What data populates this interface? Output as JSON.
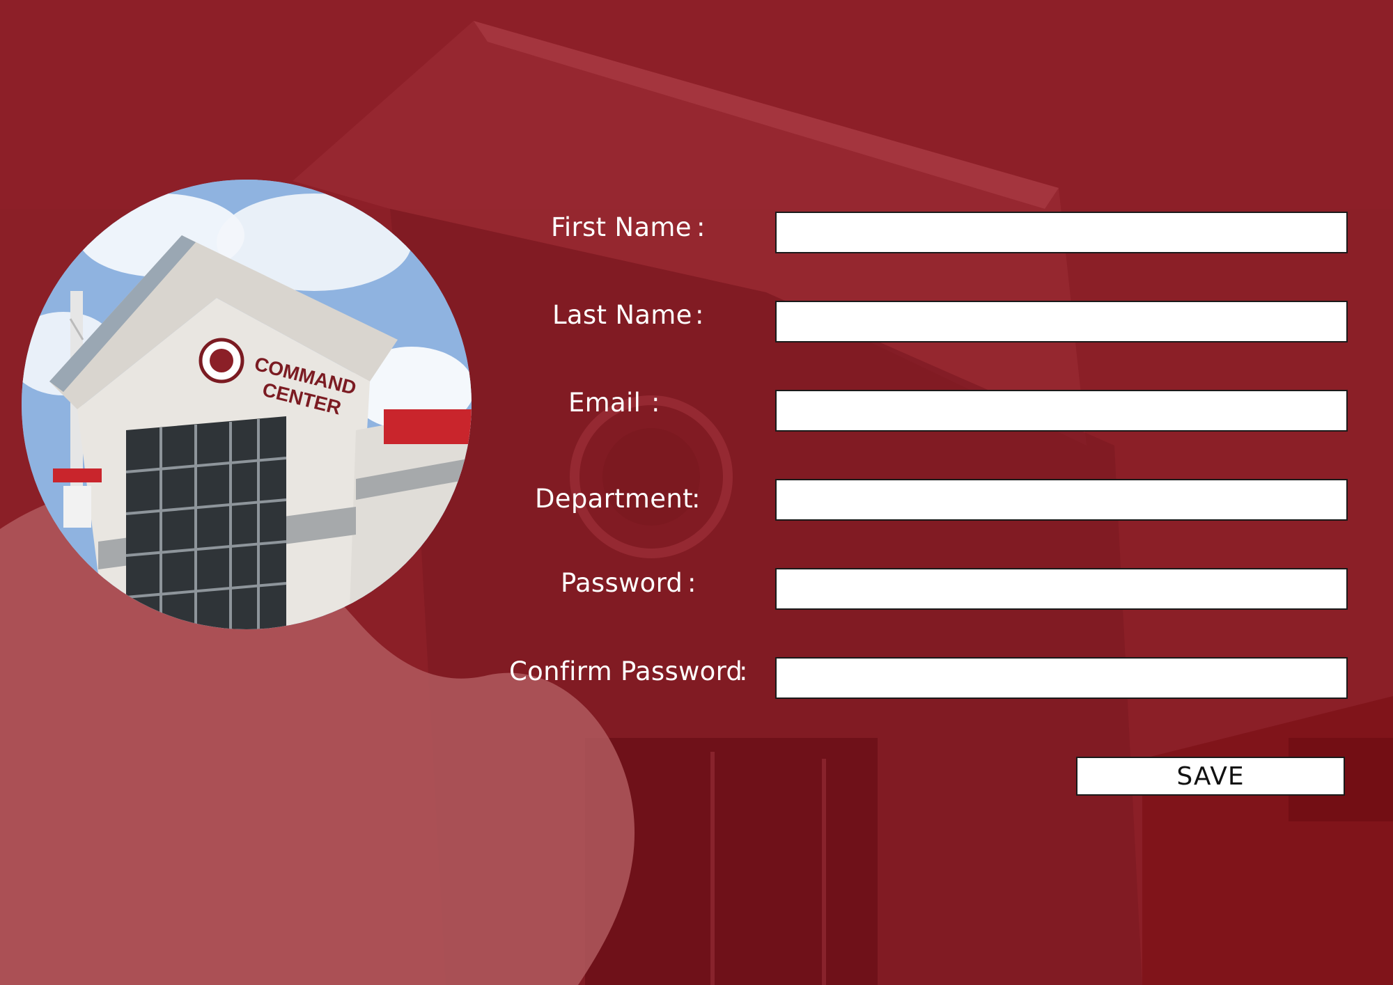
{
  "form": {
    "fields": [
      {
        "label": "First Name",
        "colon": ":",
        "value": "",
        "placeholder": ""
      },
      {
        "label": "Last Name",
        "colon": ":",
        "value": "",
        "placeholder": ""
      },
      {
        "label": "Email",
        "colon": ":",
        "value": "",
        "placeholder": ""
      },
      {
        "label": "Department",
        "colon": ":",
        "value": "",
        "placeholder": ""
      },
      {
        "label": "Password",
        "colon": ":",
        "value": "",
        "placeholder": ""
      },
      {
        "label": "Confirm Password",
        "colon": ":",
        "value": "",
        "placeholder": ""
      }
    ],
    "save_label": "SAVE"
  },
  "photo": {
    "sign_line1": "COMMAND",
    "sign_line2": "CENTER"
  },
  "colors": {
    "background": "#8a1d25",
    "accent_blob": "#a84c53",
    "input_bg": "#ffffff",
    "label_text": "#ffffff"
  }
}
